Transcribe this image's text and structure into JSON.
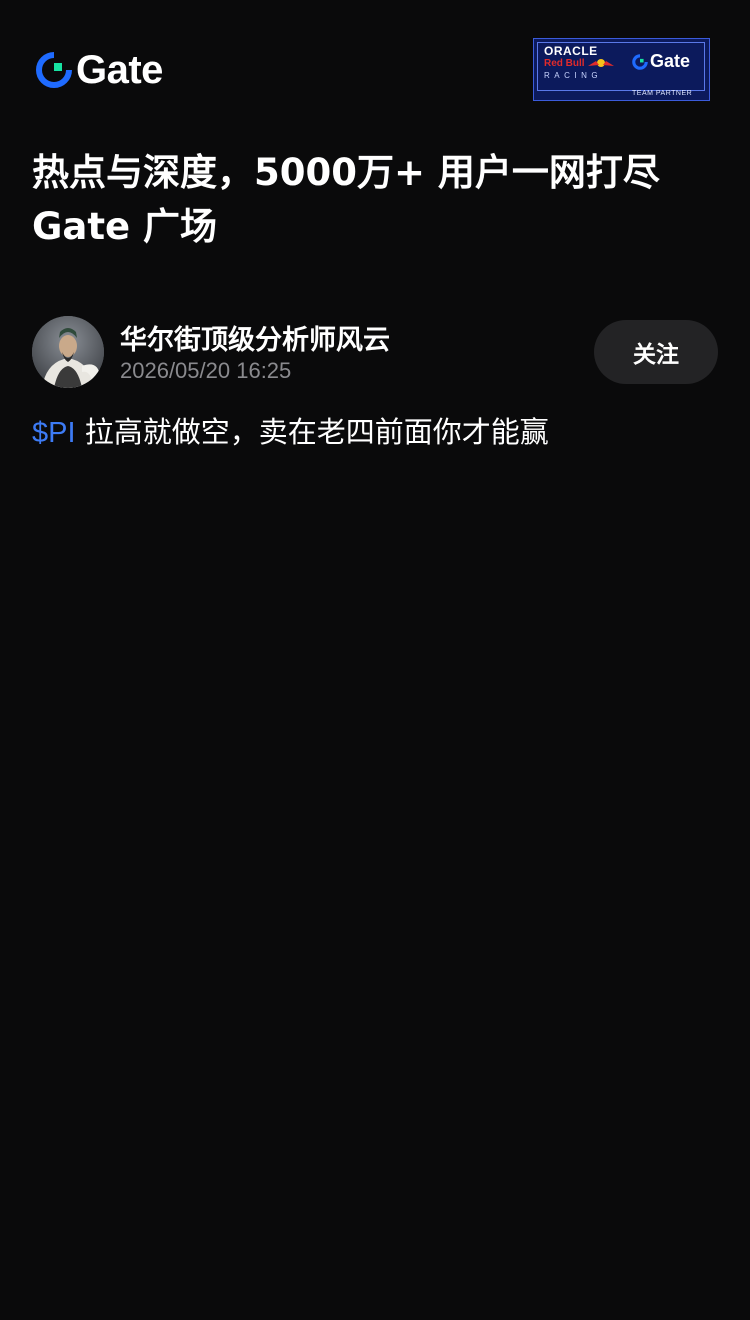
{
  "header": {
    "logo_text": "Gate",
    "partner_badge": {
      "oracle": "ORACLE",
      "redbull": "Red Bull",
      "racing": "RACING",
      "gate": "Gate",
      "team_partner": "TEAM PARTNER"
    }
  },
  "headline": {
    "line1": "热点与深度，5000万+ 用户一网打尽",
    "line2": "Gate 广场"
  },
  "post": {
    "author_name": "华尔街顶级分析师风云",
    "timestamp": "2026/05/20 16:25",
    "follow_label": "关注",
    "ticker": "$PI",
    "text": " 拉高就做空，卖在老四前面你才能赢"
  },
  "colors": {
    "background": "#0a0a0b",
    "accent_blue": "#3d7bf5",
    "logo_green": "#17e3a2",
    "follow_bg": "#232325",
    "muted_text": "#8a8a8e"
  },
  "icons": {
    "logo": "gate-logo-icon",
    "avatar": "avatar"
  }
}
